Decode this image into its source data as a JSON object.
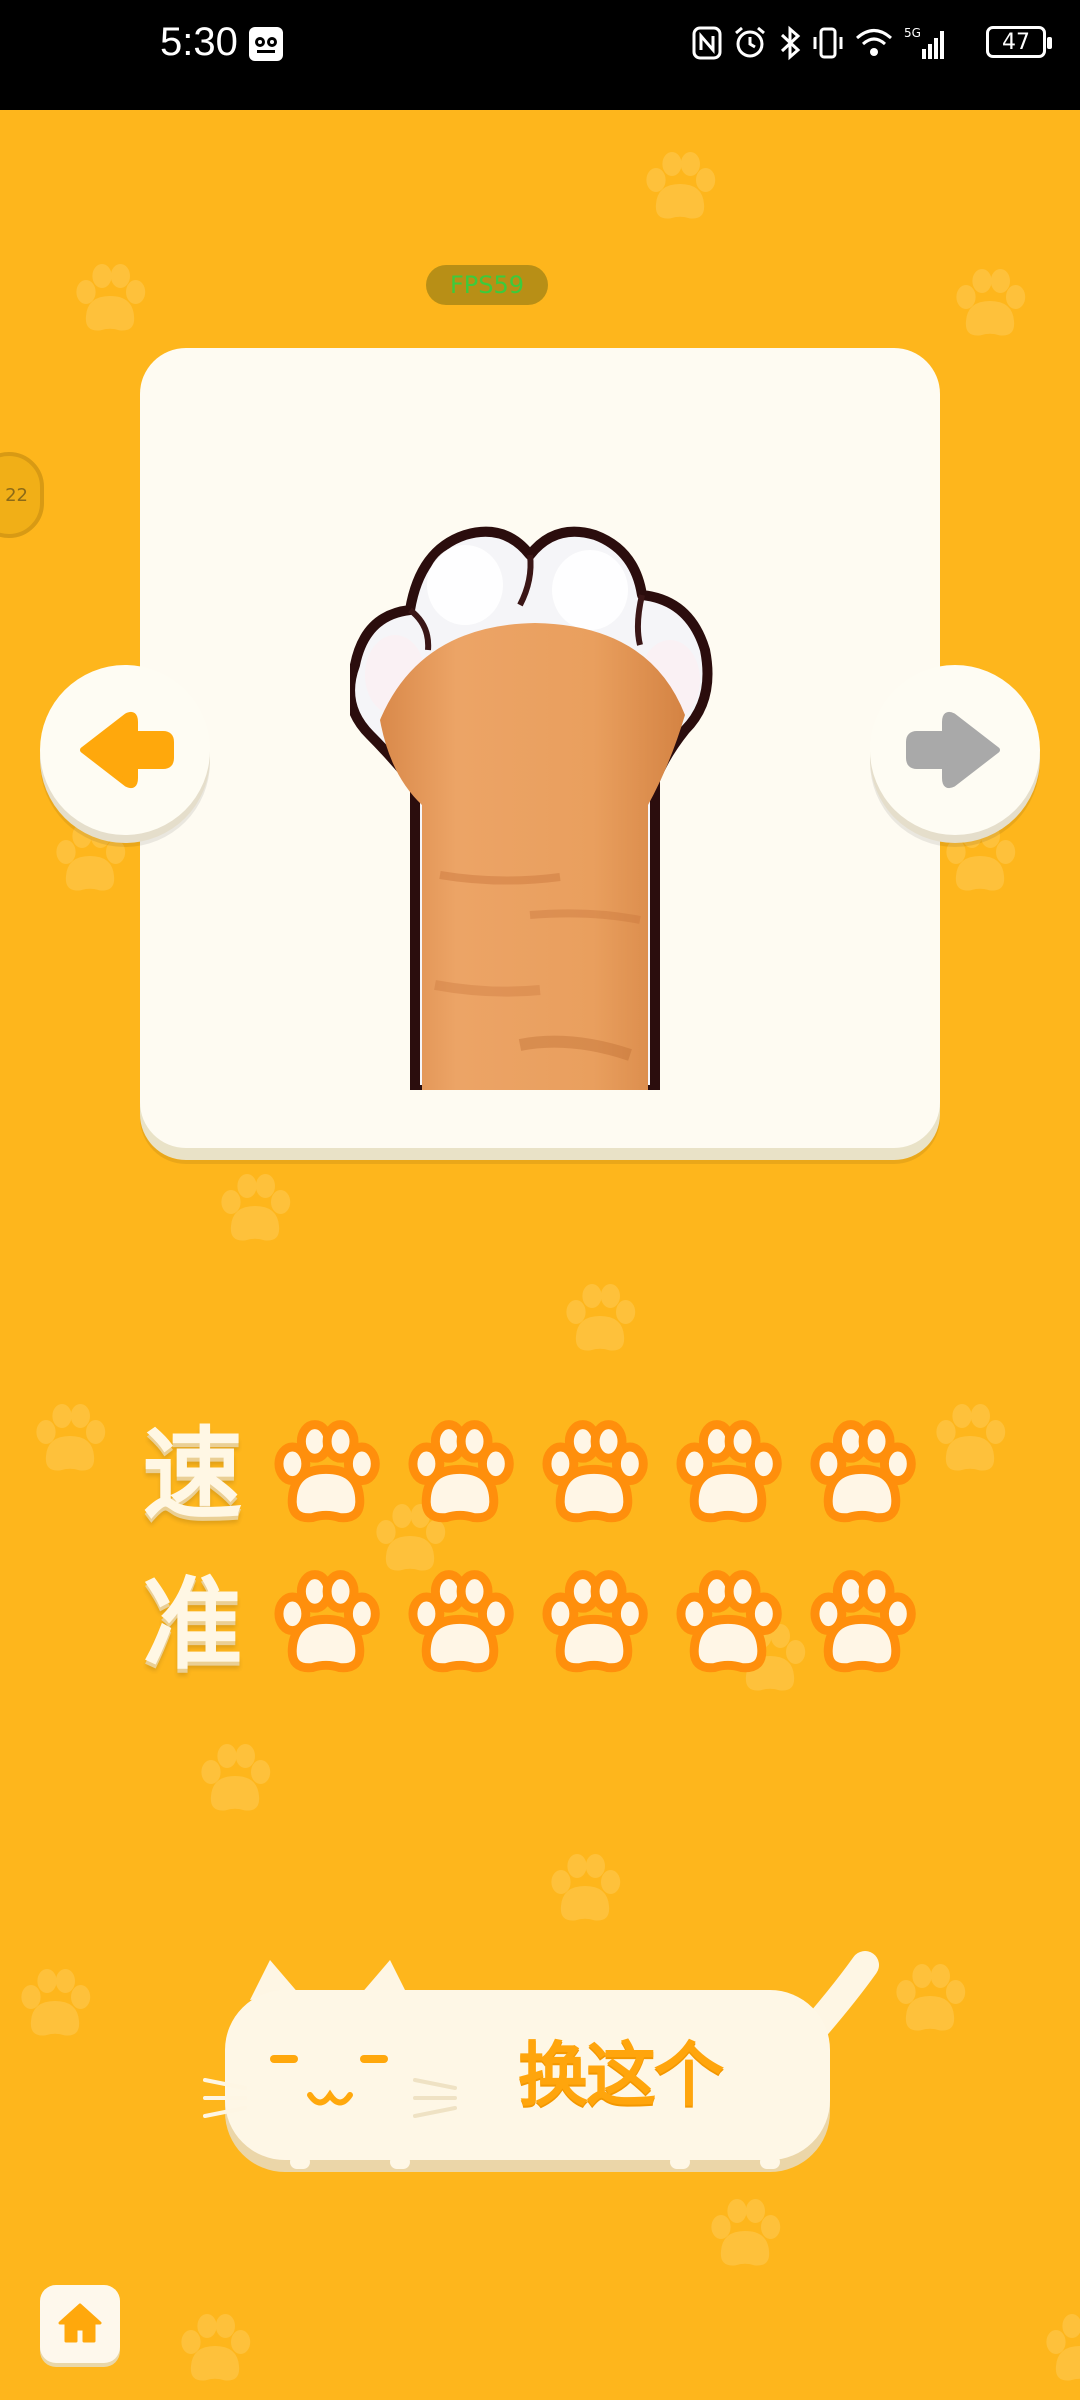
{
  "status_bar": {
    "time": "5:30",
    "battery": "47",
    "network": "5G"
  },
  "debug": {
    "fps": "FPS59"
  },
  "side_handle": {
    "text": "22"
  },
  "ratings": [
    {
      "label": "速",
      "value": 5,
      "max": 5
    },
    {
      "label": "准",
      "value": 5,
      "max": 5
    }
  ],
  "action": {
    "label": "换这个"
  },
  "icons": {
    "prev": "arrow-left-icon",
    "next": "arrow-right-icon",
    "home": "home-icon",
    "paw": "paw-icon"
  },
  "colors": {
    "background": "#FEB61C",
    "accent": "#FFA50C",
    "card": "#FEFBF2",
    "arrow_active": "#FFA80C",
    "arrow_inactive": "#A9A9A9"
  }
}
